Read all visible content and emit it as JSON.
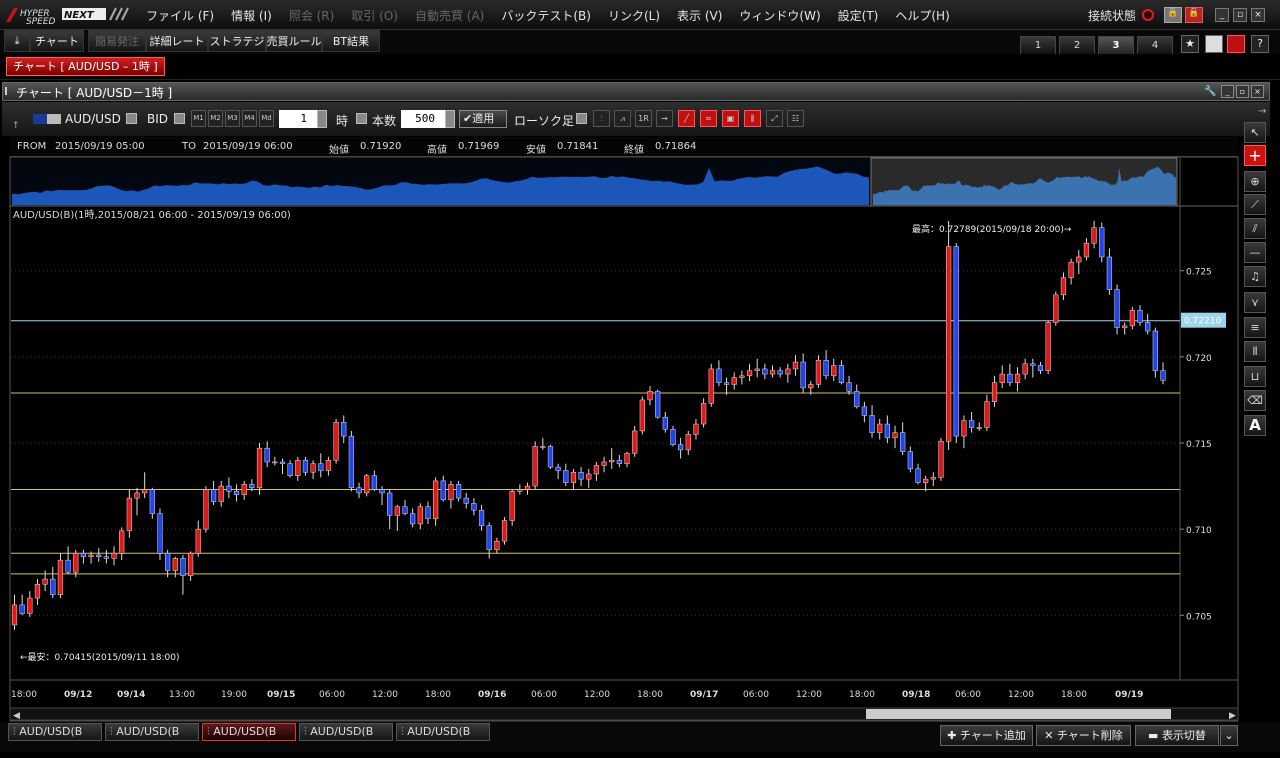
{
  "app": {
    "logo_text": "HYPER SPEED NEXT",
    "menus": [
      {
        "label": "ファイル (F)",
        "enabled": true
      },
      {
        "label": "情報 (I)",
        "enabled": true
      },
      {
        "label": "照会 (R)",
        "enabled": false
      },
      {
        "label": "取引 (O)",
        "enabled": false
      },
      {
        "label": "自動売買 (A)",
        "enabled": false
      },
      {
        "label": "バックテスト(B)",
        "enabled": true
      },
      {
        "label": "リンク(L)",
        "enabled": true
      },
      {
        "label": "表示 (V)",
        "enabled": true
      },
      {
        "label": "ウィンドウ(W)",
        "enabled": true
      },
      {
        "label": "設定(T)",
        "enabled": true
      },
      {
        "label": "ヘルプ(H)",
        "enabled": true
      }
    ],
    "connection_label": "接続状態",
    "window_controls": [
      "_",
      "▫",
      "×"
    ]
  },
  "toolbar2": {
    "items": [
      "チャート",
      "簡易発注",
      "詳細レート",
      "ストラテジ",
      "売買ルール",
      "BT結果"
    ],
    "disabled": [
      "簡易発注"
    ],
    "workspace_tabs": [
      "1",
      "2",
      "3",
      "4"
    ],
    "active_workspace": "3"
  },
  "active_window_tab": "チャート [ AUD/USD – 1時 ]",
  "chart_window": {
    "title": "チャート [ AUD/USD－1時 ]",
    "symbol": "AUD/USD",
    "price_side": "BID",
    "m_buttons": [
      "M1",
      "M2",
      "M3",
      "M4",
      "Md"
    ],
    "period_value": "1",
    "period_unit": "時",
    "count_label": "本数",
    "count_value": "500",
    "apply_label": "適用",
    "chart_type": "ローソク足",
    "tool_labels": [
      "1R"
    ]
  },
  "info": {
    "from_label": "FROM",
    "from_value": "2015/09/19 05:00",
    "to_label": "TO",
    "to_value": "2015/09/19 06:00",
    "open_label": "始値",
    "open_value": "0.71920",
    "high_label": "高値",
    "high_value": "0.71969",
    "low_label": "安値",
    "low_value": "0.71841",
    "close_label": "終値",
    "close_value": "0.71864"
  },
  "chart_data": {
    "type": "candlestick",
    "title": "AUD/USD(B)(1時,2015/08/21 06:00 - 2015/09/19 06:00)",
    "colors": {
      "up": "#e01818",
      "down": "#2244ee",
      "hline": "#d8c060",
      "current_line": "#9fd4ee",
      "grid": "#333333"
    },
    "ylim": [
      0.7013,
      0.7287
    ],
    "yticks": [
      0.705,
      0.71,
      0.715,
      0.72,
      0.725
    ],
    "ytick_labels": [
      "0.705",
      "0.710",
      "0.715",
      "0.720",
      "0.725"
    ],
    "xtick_labels": [
      "18:00",
      "09/12",
      "09/14",
      "13:00",
      "19:00",
      "09/15",
      "06:00",
      "12:00",
      "18:00",
      "09/16",
      "06:00",
      "12:00",
      "18:00",
      "09/17",
      "06:00",
      "12:00",
      "18:00",
      "09/18",
      "06:00",
      "12:00",
      "18:00",
      "09/19"
    ],
    "xtick_bold": [
      "09/12",
      "09/14",
      "09/15",
      "09/16",
      "09/17",
      "09/18",
      "09/19"
    ],
    "current_price": 0.7221,
    "current_price_label": "0.72210",
    "horizontal_lines": [
      0.7179,
      0.7123,
      0.7086,
      0.7074
    ],
    "max_annotation": "最高：0.72789(2015/09/18 20:00)→",
    "min_annotation": "←最安：0.70415(2015/09/11 18:00)",
    "candles": [
      [
        0.70444,
        0.7062,
        0.70415,
        0.7056
      ],
      [
        0.7056,
        0.7062,
        0.705,
        0.7051
      ],
      [
        0.7051,
        0.7064,
        0.7049,
        0.706
      ],
      [
        0.706,
        0.7071,
        0.7056,
        0.7068
      ],
      [
        0.7068,
        0.7076,
        0.7064,
        0.7071
      ],
      [
        0.7071,
        0.7078,
        0.706,
        0.7062
      ],
      [
        0.7062,
        0.7086,
        0.706,
        0.7082
      ],
      [
        0.7082,
        0.709,
        0.7074,
        0.7075
      ],
      [
        0.7075,
        0.7088,
        0.7072,
        0.7086
      ],
      [
        0.7086,
        0.7088,
        0.708,
        0.7084
      ],
      [
        0.7084,
        0.7087,
        0.708,
        0.7085
      ],
      [
        0.7085,
        0.7089,
        0.7081,
        0.7084
      ],
      [
        0.7084,
        0.7088,
        0.708,
        0.7083
      ],
      [
        0.7083,
        0.709,
        0.7079,
        0.7086
      ],
      [
        0.7086,
        0.7101,
        0.7082,
        0.7099
      ],
      [
        0.7099,
        0.7123,
        0.7095,
        0.7118
      ],
      [
        0.7118,
        0.7124,
        0.7108,
        0.7121
      ],
      [
        0.7121,
        0.7133,
        0.7118,
        0.7123
      ],
      [
        0.7123,
        0.7124,
        0.7106,
        0.7109
      ],
      [
        0.7109,
        0.7112,
        0.7082,
        0.7086
      ],
      [
        0.7086,
        0.7088,
        0.7072,
        0.7076
      ],
      [
        0.7076,
        0.7084,
        0.7072,
        0.7083
      ],
      [
        0.7083,
        0.7085,
        0.7062,
        0.7073
      ],
      [
        0.7073,
        0.7087,
        0.707,
        0.7086
      ],
      [
        0.7086,
        0.7105,
        0.7084,
        0.71
      ],
      [
        0.71,
        0.7125,
        0.7098,
        0.7123
      ],
      [
        0.7123,
        0.7128,
        0.7114,
        0.7116
      ],
      [
        0.7116,
        0.7128,
        0.7113,
        0.7125
      ],
      [
        0.7125,
        0.713,
        0.7118,
        0.7122
      ],
      [
        0.7122,
        0.7126,
        0.7116,
        0.712
      ],
      [
        0.712,
        0.7128,
        0.7117,
        0.7126
      ],
      [
        0.7126,
        0.7129,
        0.7122,
        0.7124
      ],
      [
        0.7124,
        0.715,
        0.712,
        0.7147
      ],
      [
        0.7147,
        0.7151,
        0.7136,
        0.7139
      ],
      [
        0.7139,
        0.7142,
        0.7137,
        0.7139
      ],
      [
        0.7139,
        0.7141,
        0.7132,
        0.7138
      ],
      [
        0.7138,
        0.714,
        0.713,
        0.7131
      ],
      [
        0.7131,
        0.7142,
        0.7128,
        0.714
      ],
      [
        0.714,
        0.7142,
        0.7131,
        0.7133
      ],
      [
        0.7133,
        0.714,
        0.7129,
        0.7138
      ],
      [
        0.7138,
        0.7144,
        0.713,
        0.7134
      ],
      [
        0.7134,
        0.7142,
        0.7131,
        0.714
      ],
      [
        0.714,
        0.7164,
        0.7138,
        0.7162
      ],
      [
        0.7162,
        0.7166,
        0.715,
        0.7154
      ],
      [
        0.7154,
        0.7157,
        0.7122,
        0.7124
      ],
      [
        0.7124,
        0.7127,
        0.7118,
        0.7121
      ],
      [
        0.7121,
        0.7132,
        0.7119,
        0.7131
      ],
      [
        0.7131,
        0.7134,
        0.7122,
        0.7123
      ],
      [
        0.7123,
        0.7125,
        0.7114,
        0.7121
      ],
      [
        0.7121,
        0.7123,
        0.71,
        0.7108
      ],
      [
        0.7108,
        0.7114,
        0.7099,
        0.7113
      ],
      [
        0.7113,
        0.7117,
        0.7108,
        0.7109
      ],
      [
        0.7109,
        0.7112,
        0.7101,
        0.7103
      ],
      [
        0.7103,
        0.7115,
        0.71,
        0.7113
      ],
      [
        0.7113,
        0.7116,
        0.7103,
        0.7106
      ],
      [
        0.7106,
        0.713,
        0.7102,
        0.7128
      ],
      [
        0.7128,
        0.7131,
        0.7116,
        0.7117
      ],
      [
        0.7117,
        0.7128,
        0.7112,
        0.7126
      ],
      [
        0.7126,
        0.7128,
        0.7116,
        0.7118
      ],
      [
        0.7118,
        0.7121,
        0.7112,
        0.7115
      ],
      [
        0.7115,
        0.7118,
        0.7108,
        0.7111
      ],
      [
        0.7111,
        0.7114,
        0.7099,
        0.7102
      ],
      [
        0.7102,
        0.7104,
        0.7083,
        0.7088
      ],
      [
        0.7088,
        0.7095,
        0.7086,
        0.7093
      ],
      [
        0.7093,
        0.7107,
        0.7091,
        0.7105
      ],
      [
        0.7105,
        0.7123,
        0.7102,
        0.7122
      ],
      [
        0.7122,
        0.7126,
        0.712,
        0.7123
      ],
      [
        0.7123,
        0.7127,
        0.712,
        0.7125
      ],
      [
        0.7125,
        0.7151,
        0.7123,
        0.7148
      ],
      [
        0.7148,
        0.7153,
        0.7146,
        0.7148
      ],
      [
        0.7148,
        0.7149,
        0.7135,
        0.7136
      ],
      [
        0.7136,
        0.7138,
        0.7129,
        0.7134
      ],
      [
        0.7134,
        0.7138,
        0.7125,
        0.7127
      ],
      [
        0.7127,
        0.7135,
        0.7123,
        0.7133
      ],
      [
        0.7133,
        0.7136,
        0.7125,
        0.7129
      ],
      [
        0.7129,
        0.7135,
        0.7124,
        0.7132
      ],
      [
        0.7132,
        0.7139,
        0.7128,
        0.7137
      ],
      [
        0.7137,
        0.7142,
        0.7133,
        0.7139
      ],
      [
        0.7139,
        0.7147,
        0.7135,
        0.714
      ],
      [
        0.714,
        0.7143,
        0.7136,
        0.7138
      ],
      [
        0.7138,
        0.7145,
        0.7136,
        0.7144
      ],
      [
        0.7144,
        0.716,
        0.7142,
        0.7157
      ],
      [
        0.7157,
        0.7177,
        0.7155,
        0.7175
      ],
      [
        0.7175,
        0.7183,
        0.7172,
        0.718
      ],
      [
        0.718,
        0.7181,
        0.7164,
        0.7165
      ],
      [
        0.7165,
        0.7168,
        0.7156,
        0.7158
      ],
      [
        0.7158,
        0.716,
        0.7148,
        0.7149
      ],
      [
        0.7149,
        0.7153,
        0.7141,
        0.7146
      ],
      [
        0.7146,
        0.7157,
        0.7143,
        0.7155
      ],
      [
        0.7155,
        0.7164,
        0.7152,
        0.7161
      ],
      [
        0.7161,
        0.7176,
        0.7159,
        0.7173
      ],
      [
        0.7173,
        0.7196,
        0.7171,
        0.7193
      ],
      [
        0.7193,
        0.7198,
        0.7183,
        0.7185
      ],
      [
        0.7185,
        0.7188,
        0.7178,
        0.7184
      ],
      [
        0.7184,
        0.7191,
        0.7181,
        0.7188
      ],
      [
        0.7188,
        0.7192,
        0.7184,
        0.7189
      ],
      [
        0.7189,
        0.7196,
        0.7186,
        0.7192
      ],
      [
        0.7192,
        0.7199,
        0.7188,
        0.7193
      ],
      [
        0.7193,
        0.7196,
        0.7187,
        0.719
      ],
      [
        0.719,
        0.7195,
        0.7188,
        0.7192
      ],
      [
        0.7192,
        0.7194,
        0.7188,
        0.719
      ],
      [
        0.719,
        0.7196,
        0.7185,
        0.7193
      ],
      [
        0.7193,
        0.7201,
        0.7189,
        0.7197
      ],
      [
        0.7197,
        0.7202,
        0.7179,
        0.7182
      ],
      [
        0.7182,
        0.7186,
        0.7178,
        0.7184
      ],
      [
        0.7184,
        0.7201,
        0.7182,
        0.7198
      ],
      [
        0.7198,
        0.7204,
        0.7187,
        0.7189
      ],
      [
        0.7189,
        0.7199,
        0.7186,
        0.7195
      ],
      [
        0.7195,
        0.7198,
        0.7184,
        0.7185
      ],
      [
        0.7185,
        0.7189,
        0.7178,
        0.718
      ],
      [
        0.718,
        0.7184,
        0.717,
        0.7171
      ],
      [
        0.7171,
        0.7174,
        0.7162,
        0.7166
      ],
      [
        0.7166,
        0.7172,
        0.7153,
        0.7156
      ],
      [
        0.7156,
        0.7164,
        0.7152,
        0.7161
      ],
      [
        0.7161,
        0.7166,
        0.715,
        0.7153
      ],
      [
        0.7153,
        0.716,
        0.7147,
        0.7156
      ],
      [
        0.7156,
        0.7162,
        0.7143,
        0.7145
      ],
      [
        0.7145,
        0.7148,
        0.7133,
        0.7135
      ],
      [
        0.7135,
        0.7138,
        0.7126,
        0.7127
      ],
      [
        0.7127,
        0.7131,
        0.7122,
        0.7129
      ],
      [
        0.7129,
        0.7133,
        0.7125,
        0.713
      ],
      [
        0.713,
        0.7153,
        0.7128,
        0.7151
      ],
      [
        0.7151,
        0.72789,
        0.7146,
        0.7264
      ],
      [
        0.7264,
        0.7266,
        0.715,
        0.7154
      ],
      [
        0.7154,
        0.7166,
        0.7147,
        0.7163
      ],
      [
        0.7163,
        0.7168,
        0.7156,
        0.7159
      ],
      [
        0.7159,
        0.7162,
        0.7157,
        0.7159
      ],
      [
        0.7159,
        0.7178,
        0.7157,
        0.7174
      ],
      [
        0.7174,
        0.7189,
        0.7171,
        0.7185
      ],
      [
        0.7185,
        0.7195,
        0.7182,
        0.719
      ],
      [
        0.719,
        0.7196,
        0.7183,
        0.7185
      ],
      [
        0.7185,
        0.7194,
        0.718,
        0.719
      ],
      [
        0.719,
        0.7199,
        0.7187,
        0.7196
      ],
      [
        0.7196,
        0.7199,
        0.7188,
        0.7195
      ],
      [
        0.7195,
        0.7197,
        0.719,
        0.7192
      ],
      [
        0.7192,
        0.7221,
        0.719,
        0.722
      ],
      [
        0.722,
        0.7238,
        0.7218,
        0.7236
      ],
      [
        0.7236,
        0.7249,
        0.7233,
        0.7246
      ],
      [
        0.7246,
        0.7257,
        0.7242,
        0.7255
      ],
      [
        0.7255,
        0.7262,
        0.7248,
        0.7258
      ],
      [
        0.7258,
        0.7269,
        0.7256,
        0.7266
      ],
      [
        0.7266,
        0.7279,
        0.7263,
        0.7275
      ],
      [
        0.7275,
        0.7278,
        0.7255,
        0.7258
      ],
      [
        0.7258,
        0.7263,
        0.7236,
        0.7239
      ],
      [
        0.7239,
        0.7242,
        0.7213,
        0.7217
      ],
      [
        0.7217,
        0.722,
        0.7213,
        0.7218
      ],
      [
        0.7218,
        0.7229,
        0.7216,
        0.7227
      ],
      [
        0.7227,
        0.723,
        0.7218,
        0.722
      ],
      [
        0.722,
        0.7225,
        0.7213,
        0.7215
      ],
      [
        0.7215,
        0.7217,
        0.7188,
        0.7192
      ],
      [
        0.7192,
        0.71969,
        0.71841,
        0.71864
      ]
    ]
  },
  "bottom": {
    "tabs": [
      "AUD/USD(B",
      "AUD/USD(B",
      "AUD/USD(B",
      "AUD/USD(B",
      "AUD/USD(B"
    ],
    "active_tab_index": 2,
    "add_chart": "チャート追加",
    "delete_chart": "チャート削除",
    "toggle_view": "表示切替"
  }
}
